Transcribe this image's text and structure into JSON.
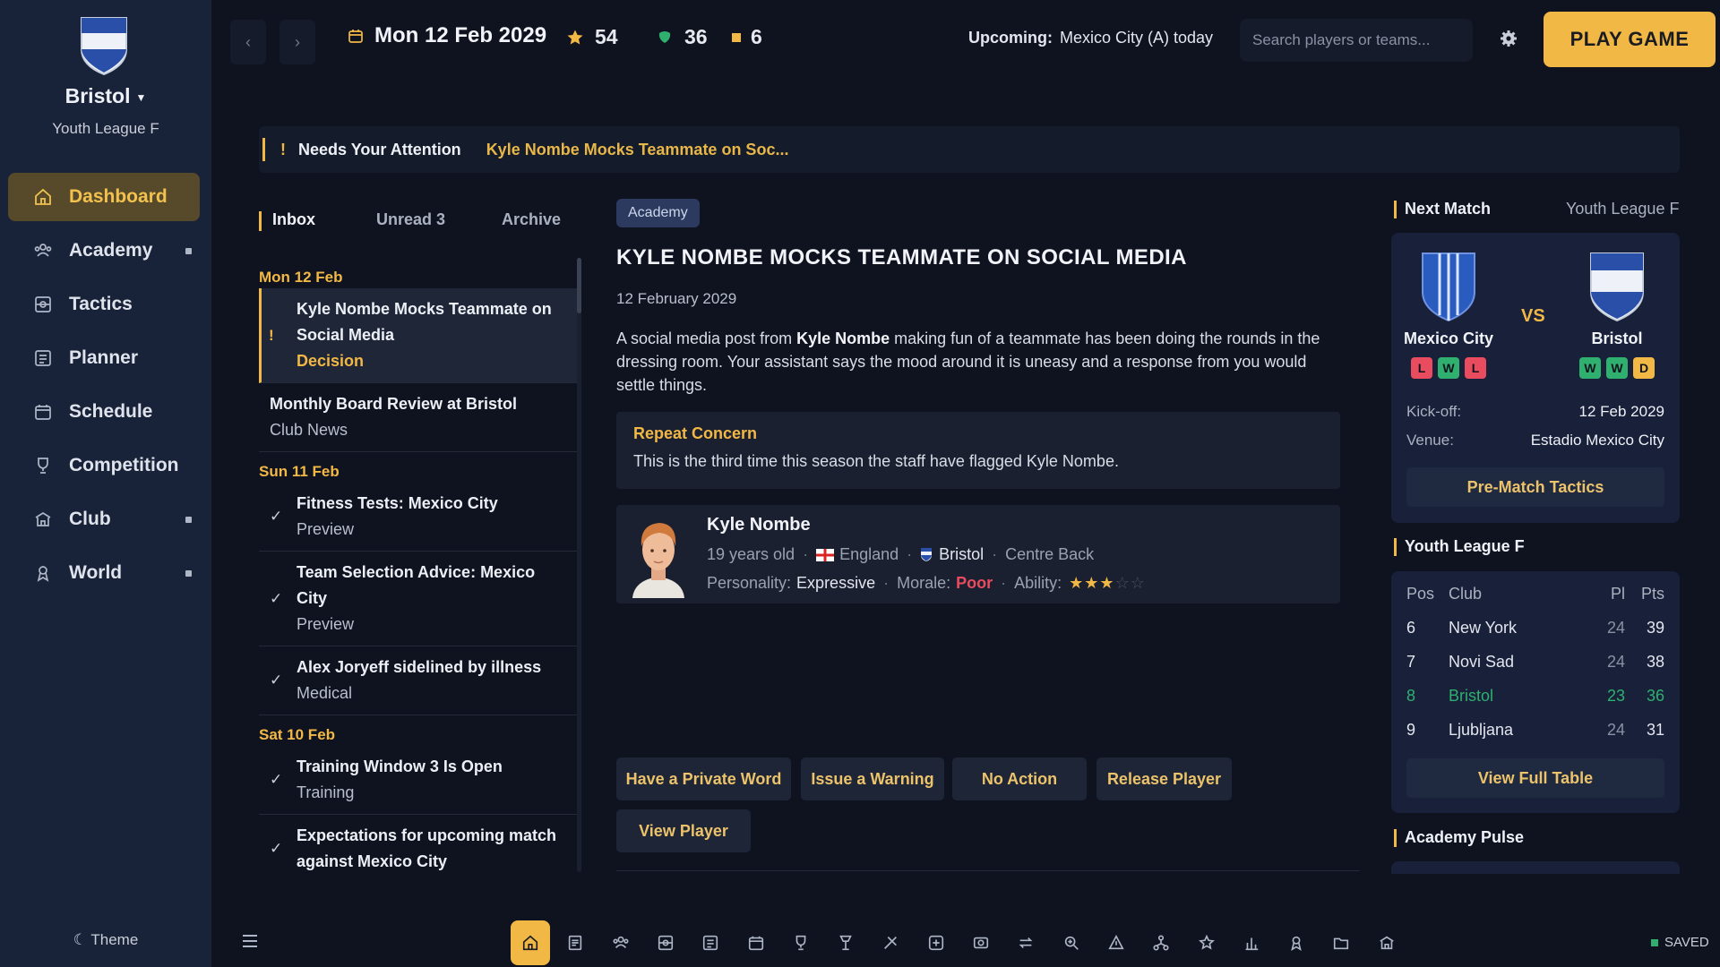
{
  "sidebar": {
    "club_name": "Bristol",
    "league": "Youth League F",
    "nav": [
      {
        "label": "Dashboard",
        "icon": "home-icon",
        "active": true
      },
      {
        "label": "Academy",
        "icon": "academy-icon",
        "has_dot": true
      },
      {
        "label": "Tactics",
        "icon": "tactics-icon"
      },
      {
        "label": "Planner",
        "icon": "planner-icon"
      },
      {
        "label": "Schedule",
        "icon": "calendar-icon"
      },
      {
        "label": "Competition",
        "icon": "trophy-icon"
      },
      {
        "label": "Club",
        "icon": "club-icon",
        "has_dot": true
      },
      {
        "label": "World",
        "icon": "world-icon",
        "has_dot": true
      }
    ],
    "theme_label": "☾ Theme"
  },
  "topbar": {
    "date": "Mon 12 Feb 2029",
    "stars": "54",
    "coins": "36",
    "tokens": "6",
    "upcoming_label": "Upcoming:",
    "upcoming_value": "Mexico City (A)  today",
    "search_placeholder": "Search players or teams...",
    "play_label": "PLAY GAME"
  },
  "attention": {
    "icon": "!",
    "label": "Needs Your Attention",
    "item": "Kyle Nombe Mocks Teammate on Soc..."
  },
  "inbox": {
    "tabs": [
      "Inbox",
      "Unread 3",
      "Archive"
    ],
    "groups": [
      {
        "day": "Mon 12 Feb",
        "messages": [
          {
            "title": "Kyle Nombe Mocks Teammate on Social Media",
            "sub": "Decision",
            "mark": "!",
            "active": true
          },
          {
            "title": "Monthly Board Review at Bristol",
            "sub": "Club News",
            "mark": ""
          }
        ]
      },
      {
        "day": "Sun 11 Feb",
        "messages": [
          {
            "title": "Fitness Tests: Mexico City",
            "sub": "Preview",
            "mark": "✓"
          },
          {
            "title": "Team Selection Advice: Mexico City",
            "sub": "Preview",
            "mark": "✓"
          },
          {
            "title": "Alex Joryeff sidelined by illness",
            "sub": "Medical",
            "mark": "✓"
          }
        ]
      },
      {
        "day": "Sat 10 Feb",
        "messages": [
          {
            "title": "Training Window 3 Is Open",
            "sub": "Training",
            "mark": "✓"
          },
          {
            "title": "Expectations for upcoming match against Mexico City",
            "sub": "",
            "mark": "✓"
          }
        ]
      }
    ]
  },
  "message": {
    "tag": "Academy",
    "title": "KYLE NOMBE MOCKS TEAMMATE ON SOCIAL MEDIA",
    "date": "12 February 2029",
    "body_pre": "A social media post from ",
    "body_name": "Kyle Nombe",
    "body_post": " making fun of a teammate has been doing the rounds in the dressing room. Your assistant says the mood around it is uneasy and a response from you would settle things.",
    "concern_title": "Repeat Concern",
    "concern_text": "This is the third time this season the staff have flagged Kyle Nombe.",
    "player": {
      "name": "Kyle Nombe",
      "age": "19 years old",
      "nation": "England",
      "club": "Bristol",
      "position": "Centre Back",
      "personality_label": "Personality:",
      "personality": "Expressive",
      "morale_label": "Morale:",
      "morale": "Poor",
      "ability_label": "Ability:",
      "ability_stars": 3,
      "ability_max": 5
    },
    "actions": [
      "Have a Private Word",
      "Issue a Warning",
      "No Action",
      "Release Player",
      "View Player"
    ]
  },
  "next_match": {
    "heading": "Next Match",
    "competition": "Youth League F",
    "home": {
      "name": "Mexico City",
      "form": [
        "L",
        "W",
        "L"
      ]
    },
    "away": {
      "name": "Bristol",
      "form": [
        "W",
        "W",
        "D"
      ]
    },
    "vs": "VS",
    "kickoff_label": "Kick-off:",
    "kickoff": "12 Feb 2029",
    "venue_label": "Venue:",
    "venue": "Estadio Mexico City",
    "button": "Pre-Match Tactics"
  },
  "league_table": {
    "heading": "Youth League F",
    "columns": [
      "Pos",
      "Club",
      "Pl",
      "Pts"
    ],
    "rows": [
      {
        "pos": "6",
        "club": "New York",
        "pl": "24",
        "pts": "39"
      },
      {
        "pos": "7",
        "club": "Novi Sad",
        "pl": "24",
        "pts": "38"
      },
      {
        "pos": "8",
        "club": "Bristol",
        "pl": "23",
        "pts": "36",
        "highlight": true
      },
      {
        "pos": "9",
        "club": "Ljubljana",
        "pl": "24",
        "pts": "31"
      }
    ],
    "button": "View Full Table"
  },
  "academy_pulse": {
    "heading": "Academy Pulse"
  },
  "dock": {
    "items": [
      "home-icon",
      "inbox-icon",
      "academy-icon",
      "tactics-icon",
      "planner-icon",
      "calendar-icon",
      "trophy-icon",
      "training-icon",
      "medical-icon",
      "add-icon",
      "finance-icon",
      "transfer-icon",
      "scout-icon",
      "staff-icon",
      "network-icon",
      "star-icon",
      "stats-icon",
      "awards-icon",
      "folder-icon",
      "club-icon"
    ],
    "active": 0
  },
  "status": {
    "saved": "SAVED"
  },
  "colors": {
    "accent": "#f2b845",
    "background": "#0f1320",
    "sidebar": "#182238",
    "win": "#2fb06f",
    "loss": "#e94c5e",
    "draw": "#f2b845"
  }
}
